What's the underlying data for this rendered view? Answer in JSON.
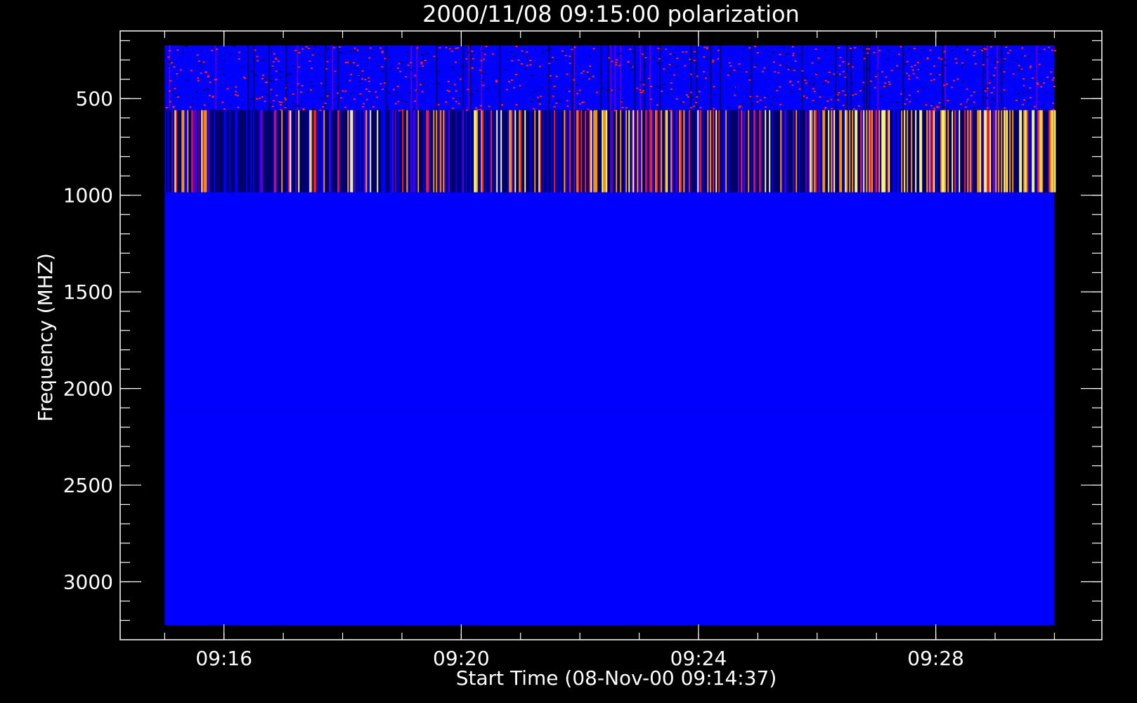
{
  "chart_data": {
    "type": "heatmap",
    "title": "2000/11/08 09:15:00 polarization",
    "xlabel": "Start Time (08-Nov-00 09:14:37)",
    "ylabel": "Frequency (MHZ)",
    "x_ticks": [
      {
        "value": 16,
        "label": "09:16"
      },
      {
        "value": 20,
        "label": "09:20"
      },
      {
        "value": 24,
        "label": "09:24"
      },
      {
        "value": 28,
        "label": "09:28"
      }
    ],
    "x_minor_step": 1,
    "y_ticks": [
      {
        "value": 500,
        "label": "500"
      },
      {
        "value": 1000,
        "label": "1000"
      },
      {
        "value": 1500,
        "label": "1500"
      },
      {
        "value": 2000,
        "label": "2000"
      },
      {
        "value": 2500,
        "label": "2500"
      },
      {
        "value": 3000,
        "label": "3000"
      }
    ],
    "y_minor_step": 100,
    "xlim": [
      14.25,
      30.8
    ],
    "ylim": [
      3300,
      150
    ],
    "y_reversed": true,
    "grid": false,
    "data_extent": {
      "x": [
        15.0,
        30.0
      ],
      "y": [
        225,
        3225
      ]
    },
    "bands": [
      {
        "y": [
          225,
          560
        ],
        "level": 0.28,
        "variability": 0.18
      },
      {
        "y": [
          560,
          985
        ],
        "level": 0.25,
        "variability": 0.75
      },
      {
        "y": [
          985,
          2110
        ],
        "level": 0.3,
        "variability": 0.1
      },
      {
        "y": [
          2110,
          3225
        ],
        "level": 0.3,
        "variability": 0.12
      }
    ],
    "colors": {
      "background": "#000000",
      "frame": "#ffffff",
      "dark_navy": "#000060",
      "blue": "#0000ff",
      "purple": "#6000c0",
      "red": "#ff2020",
      "orange": "#ff9a00",
      "yellow": "#ffff80"
    }
  }
}
